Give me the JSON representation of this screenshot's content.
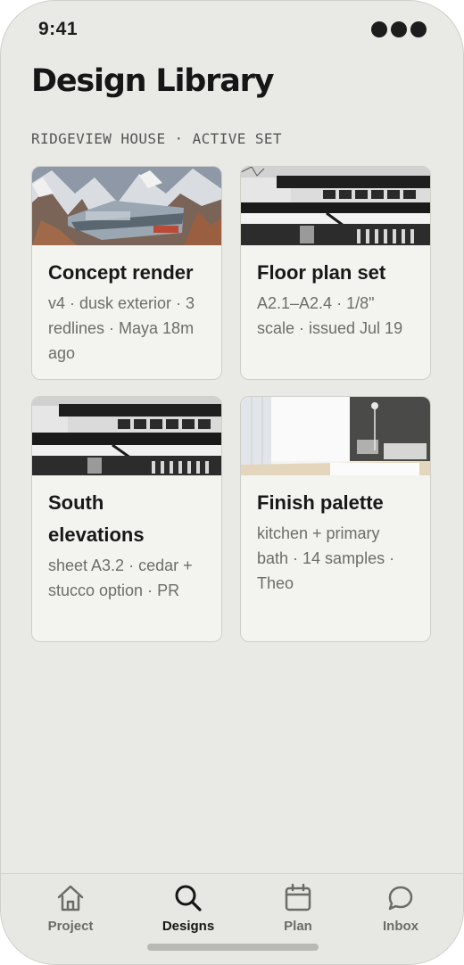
{
  "status_bar": {
    "time": "9:41"
  },
  "header": {
    "title": "Design Library",
    "project_label": "RIDGEVIEW HOUSE · ACTIVE SET"
  },
  "cards": [
    {
      "title": "Concept render",
      "meta": "v4 · dusk exterior · 3 redlines · Maya 18m ago",
      "thumbnail": "mountain-render-image"
    },
    {
      "title": "Floor plan set",
      "meta": "A2.1–A2.4 · 1/8\" scale · issued Jul 19",
      "thumbnail": "modern-house-bw-image"
    },
    {
      "title": "South elevations",
      "meta": "sheet A3.2 · cedar + stucco option · PR",
      "thumbnail": "modern-house-bw-image"
    },
    {
      "title": "Finish palette",
      "meta": "kitchen + primary bath · 14 samples · Theo",
      "thumbnail": "interior-room-image"
    }
  ],
  "tabs": [
    {
      "label": "Project",
      "icon": "home-icon",
      "active": false
    },
    {
      "label": "Designs",
      "icon": "search-icon",
      "active": true
    },
    {
      "label": "Plan",
      "icon": "calendar-icon",
      "active": false
    },
    {
      "label": "Inbox",
      "icon": "chat-bubble-icon",
      "active": false
    }
  ],
  "colors": {
    "background": "#e9e9e5",
    "card": "#f3f3f0",
    "text": "#161616",
    "muted": "#6d6d6a"
  }
}
